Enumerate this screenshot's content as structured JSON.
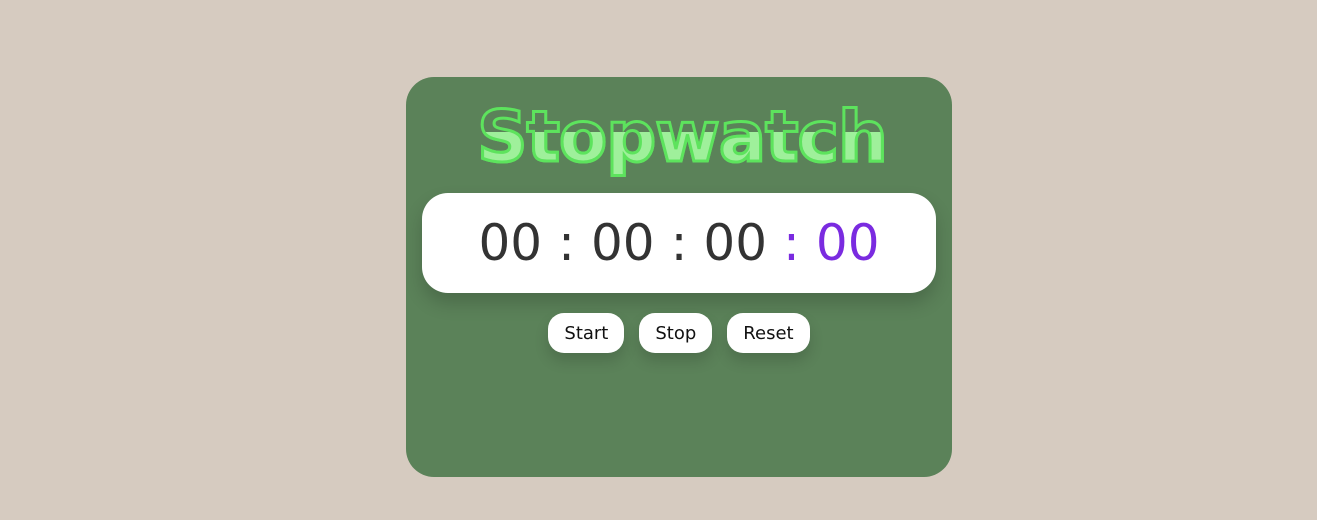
{
  "app": {
    "title": "Stopwatch"
  },
  "timer": {
    "hours": "00",
    "minutes": "00",
    "seconds": "00",
    "milliseconds": "00",
    "separator": ":"
  },
  "controls": {
    "start_label": "Start",
    "stop_label": "Stop",
    "reset_label": "Reset"
  },
  "colors": {
    "background": "#d6cbc0",
    "card": "#5b8259",
    "title_stroke": "#5de35d",
    "title_fill": "#9ff09b",
    "display_bg": "#ffffff",
    "digits": "#333333",
    "accent": "#7a2be0"
  }
}
